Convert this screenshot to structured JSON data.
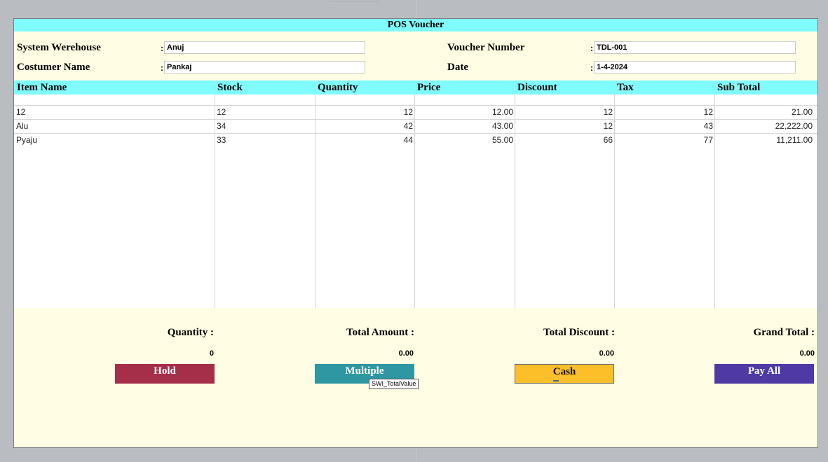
{
  "window_title": "POS Voucher",
  "header": {
    "system_warehouse": {
      "label": "System Werehouse",
      "value": "Anuj"
    },
    "customer_name": {
      "label": "Costumer Name",
      "value": "Pankaj"
    },
    "voucher_number": {
      "label": "Voucher Number",
      "value": "TDL-001"
    },
    "date": {
      "label": "Date",
      "value": "1-4-2024"
    },
    "colon": ":"
  },
  "table": {
    "columns": [
      "Item Name",
      "Stock",
      "Quantity",
      "Price",
      "Discount",
      "Tax",
      "Sub Total"
    ],
    "rows": [
      [
        "12",
        "12",
        "12",
        "12.00",
        "12",
        "12",
        "21.00"
      ],
      [
        "Alu",
        "34",
        "42",
        "43.00",
        "12",
        "43",
        "22,222.00"
      ],
      [
        "Pyaju",
        "33",
        "44",
        "55.00",
        "66",
        "77",
        "11,211.00"
      ]
    ]
  },
  "summary": {
    "quantity": {
      "label": "Quantity :",
      "value": "0"
    },
    "total_amount": {
      "label": "Total Amount :",
      "value": "0.00"
    },
    "total_discount": {
      "label": "Total Discount :",
      "value": "0.00"
    },
    "grand_total": {
      "label": "Grand Total :",
      "value": "0.00"
    }
  },
  "buttons": {
    "hold": "Hold",
    "multiple": "Multiple",
    "cash": "Cash",
    "pay_all": "Pay All"
  },
  "tooltip": "SWI_TotalValue",
  "colors": {
    "title_bar": "#7ffcfb",
    "panel_background": "#fffde3",
    "hold_button": "#a52f48",
    "multiple_button": "#2f97a1",
    "cash_button": "#fcbf2a",
    "pay_all_button": "#4e39a5"
  }
}
